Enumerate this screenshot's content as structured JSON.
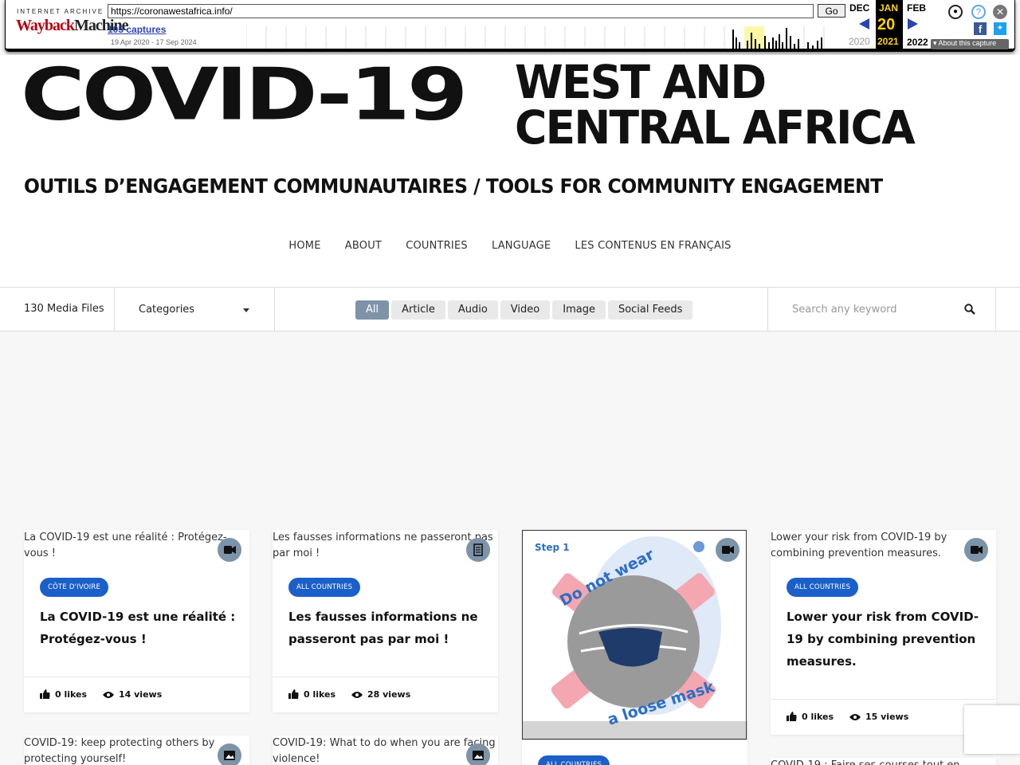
{
  "wayback": {
    "logo_top": "INTERNET ARCHIVE",
    "logo_a": "Wayback",
    "logo_b": "Machine",
    "url": "https://coronawestafrica.info/",
    "go_label": "Go",
    "captures": "105 captures",
    "range": "19 Apr 2020 - 17 Sep 2024",
    "prev_month": "DEC",
    "cur_month": "JAN",
    "next_month": "FEB",
    "cur_day": "20",
    "prev_year": "2020",
    "cur_year": "2021",
    "next_year": "2022",
    "about": "About this capture"
  },
  "hero": {
    "covid": "COVID-19",
    "region_line1": "WEST AND",
    "region_line2": "CENTRAL AFRICA",
    "tagline": "OUTILS D’ENGAGEMENT COMMUNAUTAIRES  /  TOOLS FOR COMMUNITY ENGAGEMENT"
  },
  "nav": [
    "HOME",
    "ABOUT",
    "COUNTRIES",
    "LANGUAGE",
    "LES CONTENUS EN FRANÇAIS"
  ],
  "filter": {
    "media_count": "130 Media Files",
    "categories_label": "Categories",
    "tabs": [
      "All",
      "Article",
      "Audio",
      "Video",
      "Image",
      "Social Feeds"
    ],
    "active_tab": "All",
    "search_placeholder": "Search any keyword"
  },
  "cards": [
    {
      "alt": "La COVID-19 est une réalité : Protégez-vous !",
      "media": "video",
      "badge": "CÔTE D'IVOIRE",
      "title": "La COVID-19 est une réalité : Protégez-vous !",
      "likes": "0 likes",
      "views": "14 views"
    },
    {
      "alt": "Les fausses informations ne passeront pas par moi !",
      "media": "article",
      "badge": "ALL COUNTRIES",
      "title": "Les fausses informations ne passeront pas par moi !",
      "likes": "0 likes",
      "views": "28 views"
    },
    {
      "image_step": "Step 1",
      "image_text_top": "Do not wear",
      "image_text_bottom": "a loose mask",
      "media": "video",
      "badge": "ALL COUNTRIES"
    },
    {
      "alt": "Lower your risk from COVID-19 by combining prevention measures.",
      "media": "video",
      "badge": "ALL COUNTRIES",
      "title": "Lower your risk from COVID-19 by combining prevention measures.",
      "likes": "0 likes",
      "views": "15 views"
    },
    {
      "alt": "COVID-19: keep protecting others by protecting yourself!",
      "media": "image"
    },
    {
      "alt": "COVID-19: What to do when you are facing violence!",
      "media": "image"
    },
    {
      "alt": "COVID-19 : Faire ses courses tout en"
    }
  ],
  "colors": {
    "accent": "#7d93a8",
    "badge": "#1b5fc9",
    "brand_red": "#b40010"
  }
}
